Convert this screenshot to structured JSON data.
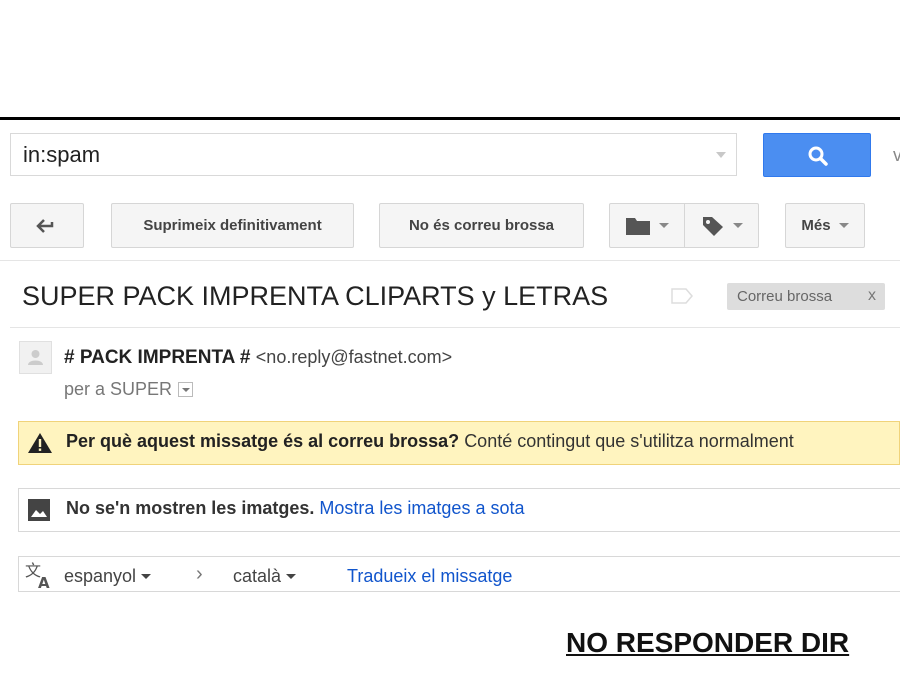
{
  "search": {
    "value": "in:spam",
    "cut_text": "v"
  },
  "toolbar": {
    "back_icon": "back-arrow-icon",
    "delete_forever_label": "Suprimeix definitivament",
    "not_spam_label": "No és correu brossa",
    "move_icon": "folder-icon",
    "labels_icon": "tag-icon",
    "more_label": "Més"
  },
  "email": {
    "subject": "SUPER PACK IMPRENTA CLIPARTS y LETRAS",
    "spam_label": "Correu brossa",
    "spam_label_remove": "x",
    "sender_name": "# PACK IMPRENTA #",
    "sender_email": "<no.reply@fastnet.com>",
    "recipient": "per a SUPER"
  },
  "spam_notice": {
    "question": "Per què aquest missatge és al correu brossa?",
    "reason": "Conté contingut que s'utilitza normalment"
  },
  "images_notice": {
    "text": "No se'n mostren les imatges.",
    "link": "Mostra les imatges a sota"
  },
  "translate": {
    "from_lang": "espanyol",
    "arrow": "›",
    "to_lang": "català",
    "link": "Tradueix el missatge"
  },
  "body": {
    "heading": "NO RESPONDER DIR"
  },
  "colors": {
    "search_button": "#4b8ef1",
    "spam_notice_bg": "#fff4bf",
    "link": "#1155cc"
  }
}
